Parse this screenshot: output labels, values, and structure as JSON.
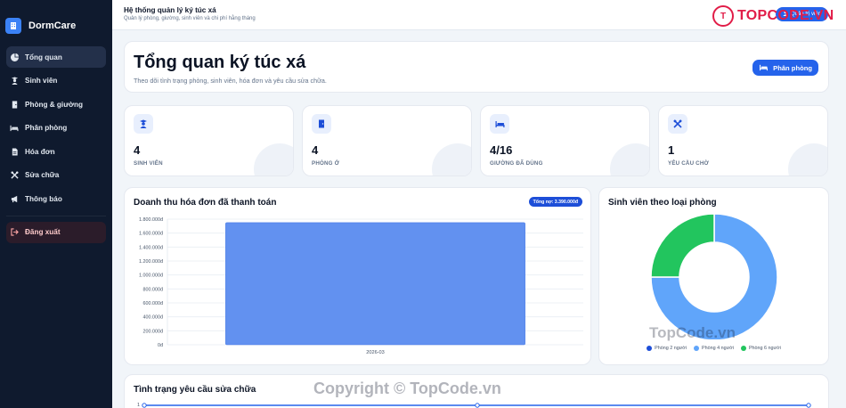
{
  "app": {
    "brand": "DormCare"
  },
  "sidebar": {
    "items": [
      {
        "label": "Tổng quan",
        "icon": "pie-chart-icon",
        "active": true
      },
      {
        "label": "Sinh viên",
        "icon": "user-graduate-icon"
      },
      {
        "label": "Phòng & giường",
        "icon": "door-icon"
      },
      {
        "label": "Phân phòng",
        "icon": "bed-icon"
      },
      {
        "label": "Hóa đơn",
        "icon": "invoice-icon"
      },
      {
        "label": "Sửa chữa",
        "icon": "tools-icon"
      },
      {
        "label": "Thông báo",
        "icon": "megaphone-icon"
      }
    ],
    "logout": "Đăng xuất"
  },
  "topbar": {
    "title": "Hệ thống quản lý ký túc xá",
    "subtitle": "Quản lý phòng, giường, sinh viên và chi phí hằng tháng",
    "user_button": "Quản trị viên"
  },
  "watermark": {
    "logo_text": "TOPCODE.VN",
    "mid": "TopCode.vn",
    "bottom": "Copyright © TopCode.vn"
  },
  "hero": {
    "title": "Tổng quan ký túc xá",
    "subtitle": "Theo dõi tình trạng phòng, sinh viên, hóa đơn và yêu cầu sửa chữa.",
    "button": "Phân phòng"
  },
  "stats": [
    {
      "value": "4",
      "label": "SINH VIÊN",
      "icon": "user-graduate-icon"
    },
    {
      "value": "4",
      "label": "PHÒNG Ở",
      "icon": "door-icon"
    },
    {
      "value": "4/16",
      "label": "GIƯỜNG ĐÃ DÙNG",
      "icon": "bed-icon"
    },
    {
      "value": "1",
      "label": "YÊU CẦU CHỜ",
      "icon": "tools-icon"
    }
  ],
  "revenue": {
    "title": "Doanh thu hóa đơn đã thanh toán",
    "badge": "Tổng nợ: 3.390.000đ"
  },
  "donut": {
    "title": "Sinh viên theo loại phòng"
  },
  "repair": {
    "title": "Tình trạng yêu cầu sửa chữa",
    "first_tick": "1"
  },
  "colors": {
    "accent": "#2563eb",
    "sidebar": "#0f1a2e",
    "bar": "#6291f0",
    "room2": "#1d4ed8",
    "room4": "#60a5fa",
    "room6": "#22c55e"
  },
  "chart_data": [
    {
      "type": "bar",
      "categories": [
        "2026-03"
      ],
      "values": [
        1750000
      ],
      "ylim": [
        0,
        1800000
      ],
      "yticks": [
        "1.800.000đ",
        "1.600.000đ",
        "1.400.000đ",
        "1.200.000đ",
        "1.000.000đ",
        "800.000đ",
        "600.000đ",
        "400.000đ",
        "200.000đ",
        "0đ"
      ],
      "grid": true
    },
    {
      "type": "pie",
      "categories": [
        "Phòng 2 người",
        "Phòng 4 người",
        "Phòng 6 người"
      ],
      "values": [
        0,
        3,
        1
      ],
      "legend": "bottom"
    }
  ]
}
